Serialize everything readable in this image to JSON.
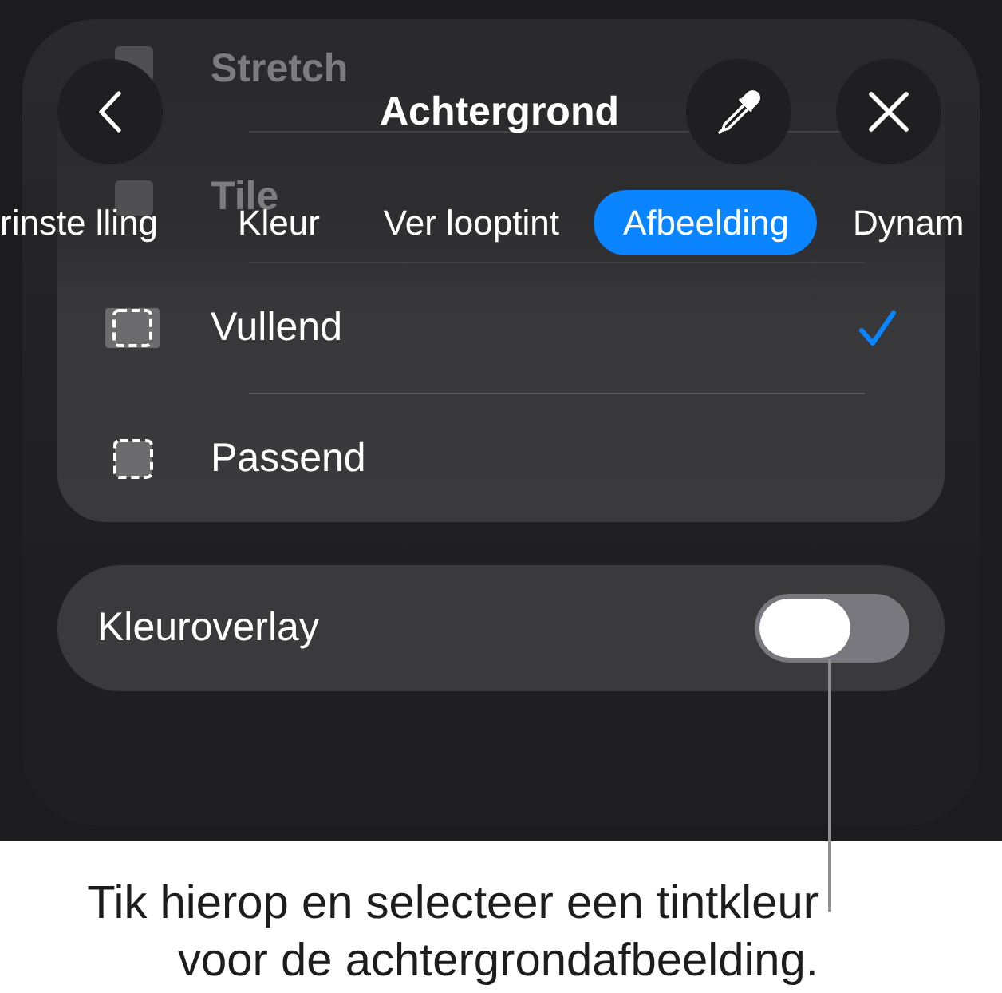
{
  "header": {
    "title": "Achtergrond"
  },
  "scrolled_rows": [
    {
      "label": "Stretch"
    },
    {
      "label": "Tile"
    }
  ],
  "tabs": [
    {
      "label": "rinste lling",
      "selected": false
    },
    {
      "label": "Kleur",
      "selected": false
    },
    {
      "label": "Ver looptint",
      "selected": false
    },
    {
      "label": "Afbeelding",
      "selected": true
    },
    {
      "label": "Dynam",
      "selected": false
    }
  ],
  "options": [
    {
      "label": "Vullend",
      "kind": "fill",
      "selected": true
    },
    {
      "label": "Passend",
      "kind": "fit",
      "selected": false
    }
  ],
  "overlay": {
    "label": "Kleuroverlay",
    "on": false
  },
  "callout": {
    "text": "Tik hierop en selecteer een tintkleur voor de achtergrondafbeelding."
  }
}
